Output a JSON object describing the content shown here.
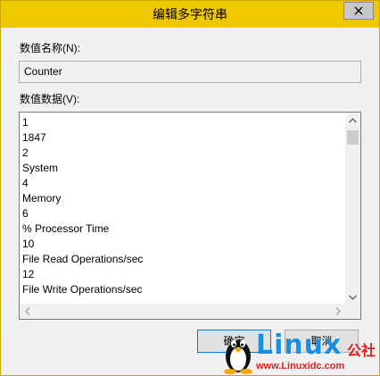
{
  "window": {
    "title": "编辑多字符串"
  },
  "value_name": {
    "label": "数值名称(N):",
    "value": "Counter"
  },
  "value_data": {
    "label": "数值数据(V):",
    "lines": [
      "1",
      "1847",
      "2",
      "System",
      "4",
      "Memory",
      "6",
      "% Processor Time",
      "10",
      "File Read Operations/sec",
      "12",
      "File Write Operations/sec"
    ]
  },
  "buttons": {
    "ok": "确定",
    "cancel": "取消"
  },
  "watermark": {
    "brand": "Linux",
    "brand_cn": "公社",
    "url": "www.Linuxidc.com"
  },
  "colors": {
    "titlebar": "#f0c800",
    "watermark_blue": "#1a8fe0",
    "watermark_red": "#e02020"
  },
  "icons": {
    "close": "close-icon",
    "scroll_up": "chevron-up-icon",
    "scroll_down": "chevron-down-icon",
    "scroll_left": "chevron-left-icon",
    "scroll_right": "chevron-right-icon",
    "mascot": "tux-penguin-icon"
  }
}
